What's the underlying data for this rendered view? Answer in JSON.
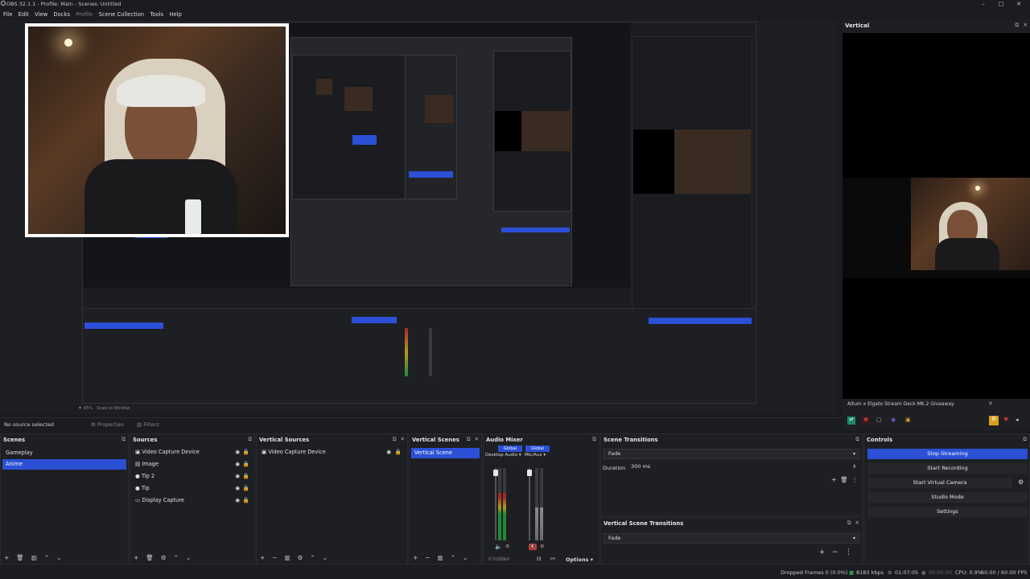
{
  "window": {
    "title": "OBS 32.1.1 - Profile: Main - Scenes: Untitled",
    "controls": [
      "–",
      "□",
      "✕"
    ]
  },
  "menu": [
    "File",
    "Edit",
    "View",
    "Docks",
    "Profile",
    "Scene Collection",
    "Tools",
    "Help"
  ],
  "preview_status": {
    "zoom": "65%",
    "mode": "Scale to Window"
  },
  "source_toolbar": {
    "no_source": "No source selected",
    "properties": "Properties",
    "filters": "Filters"
  },
  "scenes": {
    "title": "Scenes",
    "items": [
      "Gameplay",
      "Anime"
    ],
    "selected": "Anime"
  },
  "sources": {
    "title": "Sources",
    "items": [
      {
        "label": "Video Capture Device",
        "icon": "camera-icon"
      },
      {
        "label": "Image",
        "icon": "image-icon"
      },
      {
        "label": "Tip 2",
        "icon": "dot-icon"
      },
      {
        "label": "Tip",
        "icon": "dot-icon"
      },
      {
        "label": "Display Capture",
        "icon": "display-icon"
      }
    ]
  },
  "vertical_sources": {
    "title": "Vertical Sources",
    "items": [
      {
        "label": "Video Capture Device",
        "icon": "camera-icon"
      }
    ]
  },
  "vertical_scenes": {
    "title": "Vertical Scenes",
    "items": [
      "Vertical Scene"
    ],
    "selected": "Vertical Scene"
  },
  "audio_mixer": {
    "title": "Audio Mixer",
    "channels": [
      {
        "global_label": "Global",
        "name": "Desktop Audio",
        "level": 0.65
      },
      {
        "global_label": "Global",
        "name": "Mic/Aux",
        "level": 0.45
      }
    ],
    "hidden": "0 hidden",
    "options": "Options"
  },
  "scene_transitions": {
    "title": "Scene Transitions",
    "transition": "Fade",
    "duration_label": "Duration",
    "duration_value": "300 ms"
  },
  "vertical_scene_transitions": {
    "title": "Vertical Scene Transitions",
    "transition": "Fade"
  },
  "controls": {
    "title": "Controls",
    "stop_streaming": "Stop Streaming",
    "start_recording": "Start Recording",
    "start_virtual_camera": "Start Virtual Camera",
    "studio_mode": "Studio Mode",
    "settings": "Settings"
  },
  "vertical_panel": {
    "title": "Vertical",
    "giveaway_text": "Aitum x Elgato Stream Deck MK.2 Giveaway"
  },
  "statusbar": {
    "dropped_frames": "Dropped Frames 0 (0.0%)",
    "bitrate": "8183 kbps",
    "stream_time": "01:07:05",
    "rec_time": "00:00:00",
    "cpu": "CPU: 0.9%",
    "fps": "60.00 / 60.00 FPS"
  },
  "colors": {
    "accent": "#2b50d6",
    "panel": "#1e1f23",
    "background": "#1b1c20"
  }
}
